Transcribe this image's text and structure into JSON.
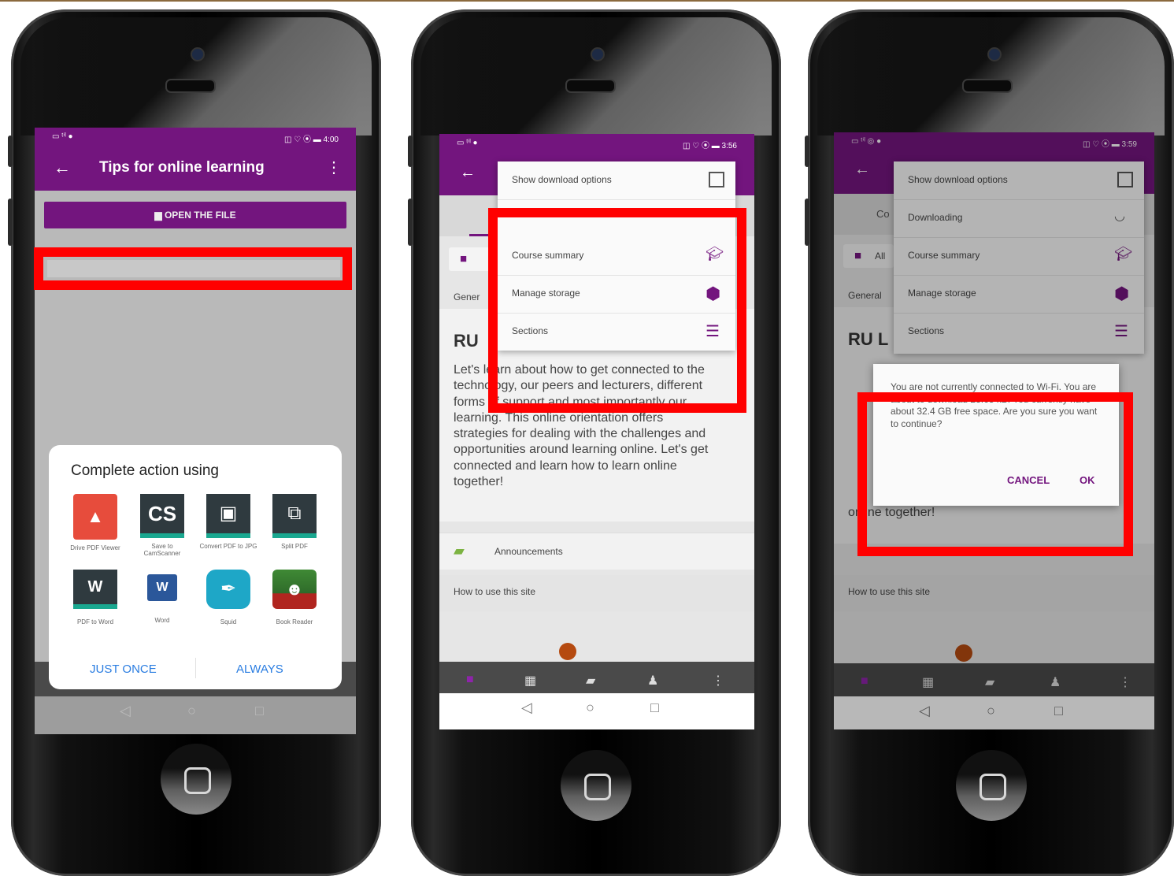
{
  "phone1": {
    "app_title": "Tips for online learning",
    "open_file_label": "OPEN THE FILE",
    "sheet_title": "Complete action using",
    "apps": [
      {
        "label": "Drive PDF Viewer",
        "icon": "drive-pdf-icon",
        "color": "#e74c3c"
      },
      {
        "label": "Save to CamScanner",
        "icon": "camscanner-icon",
        "color": "#2f3a3f"
      },
      {
        "label": "Convert PDF to JPG",
        "icon": "pdf-to-jpg-icon",
        "color": "#2f3a3f"
      },
      {
        "label": "Split PDF",
        "icon": "split-pdf-icon",
        "color": "#2f3a3f"
      },
      {
        "label": "PDF to Word",
        "icon": "pdf-to-word-icon",
        "color": "#2f3a3f"
      },
      {
        "label": "Word",
        "icon": "word-icon",
        "color": "#2b579a"
      },
      {
        "label": "Squid",
        "icon": "squid-icon",
        "color": "#1ea7c7"
      },
      {
        "label": "Book Reader",
        "icon": "book-reader-icon",
        "color": "#2f6b2a"
      }
    ],
    "camscanner_glyph": "CS",
    "word_glyph": "W",
    "just_once_label": "JUST ONCE",
    "always_label": "ALWAYS"
  },
  "phone2": {
    "menu_items": [
      {
        "label": "Show download options",
        "icon": "checkbox-icon"
      },
      {
        "label": "Course summary",
        "icon": "graduation-cap-icon"
      },
      {
        "label": "Manage storage",
        "icon": "cube-icon"
      },
      {
        "label": "Sections",
        "icon": "menu-lines-icon"
      }
    ],
    "general_label": "Gener",
    "heading_partial": "RU",
    "body_text": "Let's learn about how to get connected to the technology, our peers and lecturers, different forms of support and most importantly our learning. This online orientation offers strategies for dealing with the challenges and opportunities around learning online. Let's get connected and learn how to learn online together!",
    "announcements_label": "Announcements",
    "how_to_use_label": "How to use this site"
  },
  "phone3": {
    "menu_items": [
      {
        "label": "Show download options",
        "icon": "checkbox-icon"
      },
      {
        "label": "Downloading",
        "icon": "spinner-icon"
      },
      {
        "label": "Course summary",
        "icon": "graduation-cap-icon"
      },
      {
        "label": "Manage storage",
        "icon": "cube-icon"
      },
      {
        "label": "Sections",
        "icon": "menu-lines-icon"
      }
    ],
    "tab_partial": "Co",
    "all_label": "All",
    "general_label": "General",
    "heading_partial": "RU L",
    "dialog_text": "You are not currently connected to Wi-Fi. You are about to download 23.63 kB. You currently have about 32.4 GB free space. Are you sure you want to continue?",
    "cancel_label": "CANCEL",
    "ok_label": "OK",
    "body_fragment": "online together!",
    "how_to_use_label": "How to use this site"
  },
  "colors": {
    "accent": "#73157e",
    "highlight": "#ff0000"
  }
}
